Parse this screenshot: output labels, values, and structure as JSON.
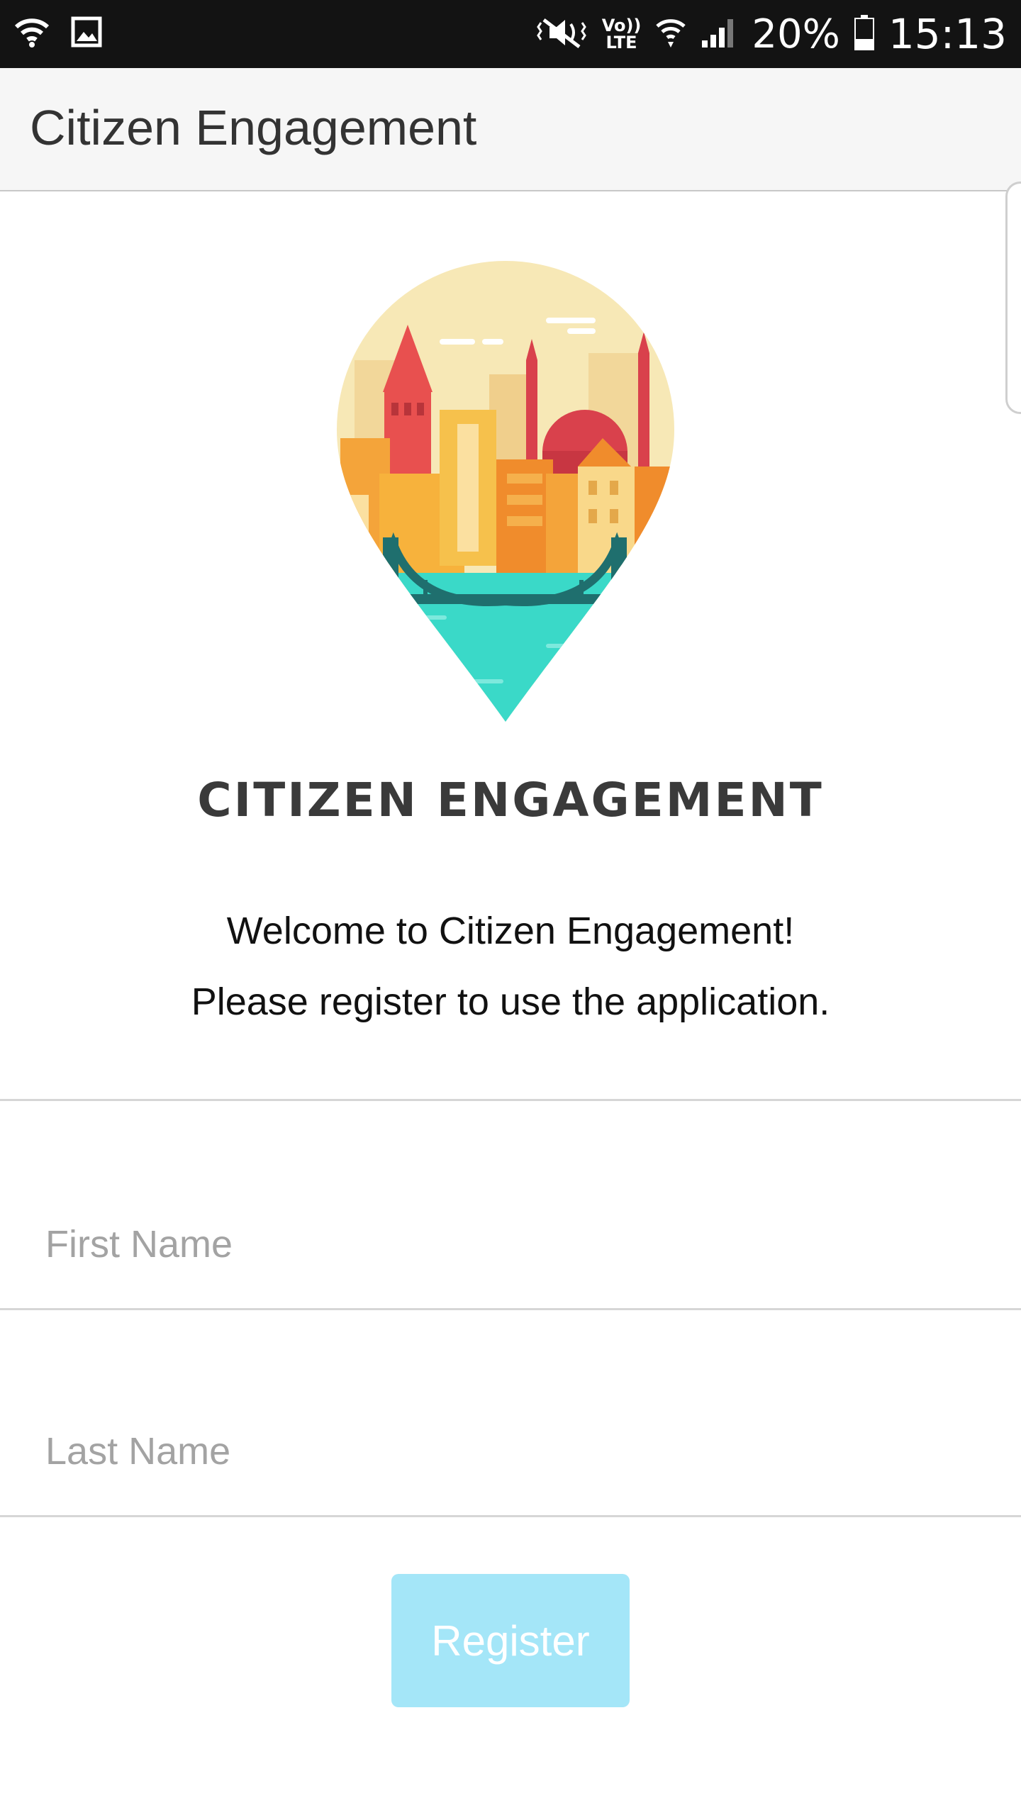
{
  "status_bar": {
    "battery_percent": "20%",
    "time": "15:13",
    "network_label": "LTE",
    "volte_label": "Vo))",
    "icons": [
      "wifi-icon",
      "gallery-icon",
      "mute-icon",
      "volte-icon",
      "wifi-calling-icon",
      "signal-icon",
      "battery-icon"
    ]
  },
  "app_bar": {
    "title": "Citizen Engagement"
  },
  "brand": {
    "name": "CITIZEN ENGAGEMENT",
    "logo_icon": "city-map-pin-logo"
  },
  "intro": {
    "welcome": "Welcome to Citizen Engagement!",
    "instructions": "Please register to use the application."
  },
  "form": {
    "first_name": {
      "value": "",
      "placeholder": "First Name"
    },
    "last_name": {
      "value": "",
      "placeholder": "Last Name"
    },
    "register_label": "Register"
  },
  "colors": {
    "status_bar_bg": "#131313",
    "app_bar_bg": "#f6f6f6",
    "register_button_bg": "#a4e6f8",
    "placeholder": "#a3a3a3"
  }
}
